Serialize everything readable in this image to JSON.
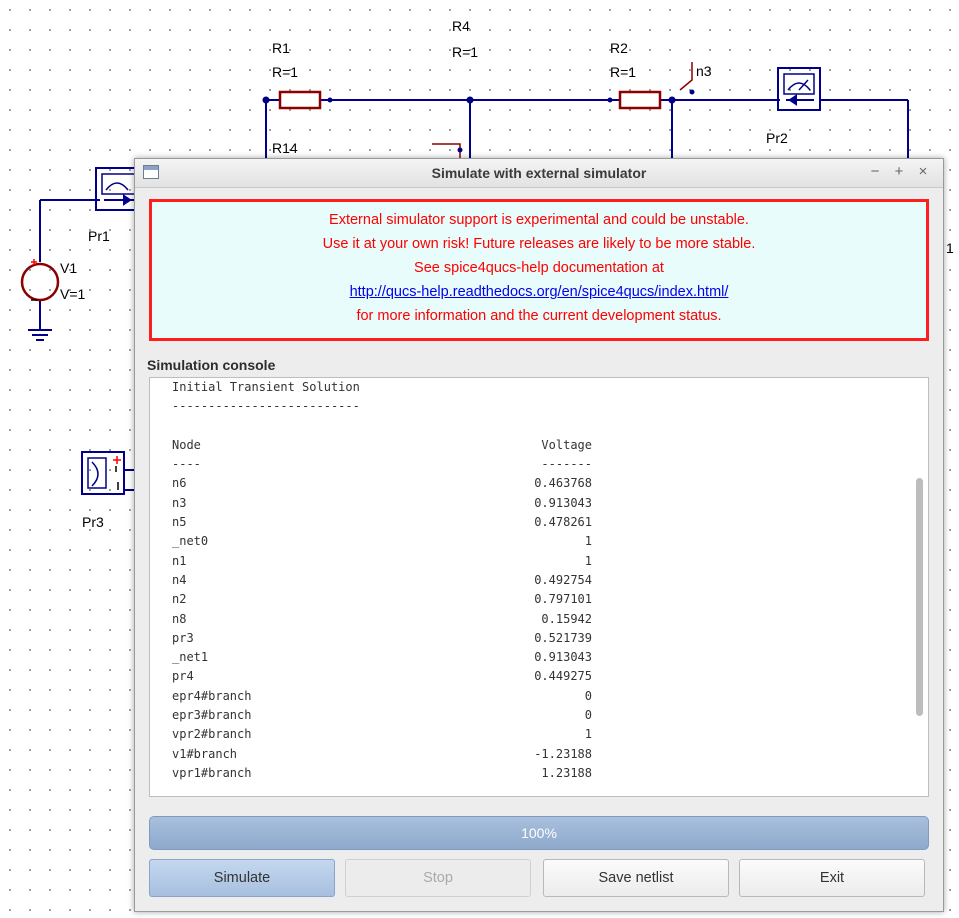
{
  "schematic": {
    "labels": {
      "r1_name": "R1",
      "r1_value": "R=1",
      "r4_name": "R4",
      "r4_value": "R=1",
      "r2_name": "R2",
      "r2_value": "R=1",
      "r14_name": "R14",
      "n3": "n3",
      "pr1": "Pr1",
      "pr2": "Pr2",
      "pr3": "Pr3",
      "v1_name": "V1",
      "v1_value": "V=1",
      "edge_right": "1"
    },
    "colors": {
      "wire": "#00008b",
      "component": "#8b0000",
      "node": "#000080",
      "dot_grid": "#8a8a8a"
    }
  },
  "dialog": {
    "title": "Simulate with external simulator",
    "window_buttons": [
      "−",
      "+",
      "×"
    ],
    "warning": {
      "line1": "External simulator support is experimental and could be unstable.",
      "line2": "Use it at your own risk! Future releases are likely to be more stable.",
      "line3": "See spice4qucs-help documentation at",
      "link": "http://qucs-help.readthedocs.org/en/spice4qucs/index.html/",
      "line5": "for more information and the current development status."
    },
    "console_label": "Simulation console",
    "console": {
      "heading": "Initial Transient Solution",
      "heading_rule": "--------------------------",
      "col_node": "Node",
      "col_voltage": "Voltage",
      "rule_node": "----",
      "rule_voltage": "-------",
      "rows": [
        {
          "node": "n6",
          "value": "0.463768"
        },
        {
          "node": "n3",
          "value": "0.913043"
        },
        {
          "node": "n5",
          "value": "0.478261"
        },
        {
          "node": "_net0",
          "value": "1"
        },
        {
          "node": "n1",
          "value": "1"
        },
        {
          "node": "n4",
          "value": "0.492754"
        },
        {
          "node": "n2",
          "value": "0.797101"
        },
        {
          "node": "n8",
          "value": "0.15942"
        },
        {
          "node": "pr3",
          "value": "0.521739"
        },
        {
          "node": "_net1",
          "value": "0.913043"
        },
        {
          "node": "pr4",
          "value": "0.449275"
        },
        {
          "node": "epr4#branch",
          "value": "0"
        },
        {
          "node": "epr3#branch",
          "value": "0"
        },
        {
          "node": "vpr2#branch",
          "value": "1"
        },
        {
          "node": "v1#branch",
          "value": "-1.23188"
        },
        {
          "node": "vpr1#branch",
          "value": "1.23188"
        }
      ]
    },
    "progress_text": "100%",
    "progress_value": 1.0,
    "buttons": {
      "simulate": "Simulate",
      "stop": "Stop",
      "save_netlist": "Save netlist",
      "exit": "Exit"
    },
    "colors": {
      "warning_text": "#ff0000",
      "warning_border": "#ff1d1d",
      "warning_bg": "#e8fcfc",
      "link": "#0000ee",
      "progress": "#9bb5d6"
    }
  }
}
